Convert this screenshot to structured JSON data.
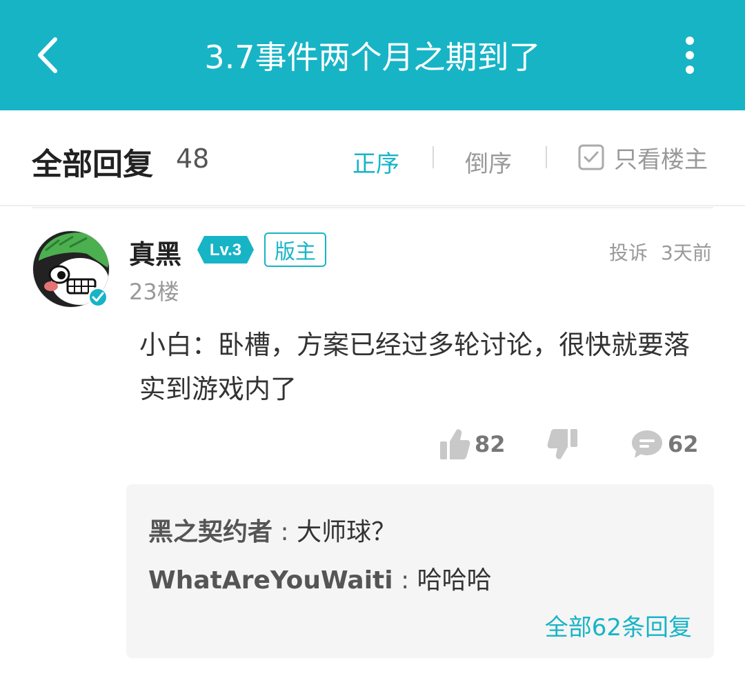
{
  "header": {
    "title": "3.7事件两个月之期到了",
    "back_icon": "chevron-left-icon",
    "more_icon": "more-vertical-icon",
    "bar_color": "#17b4c6"
  },
  "reply_header": {
    "title": "全部回复",
    "count": "48",
    "sort_asc": "正序",
    "sort_desc": "倒序",
    "only_op": "只看楼主",
    "active_sort": "正序"
  },
  "post": {
    "username": "真黑",
    "level": "Lv.3",
    "role": "版主",
    "report": "投诉",
    "time": "3天前",
    "floor": "23楼",
    "content": "小白：卧槽，方案已经过多轮讨论，很快就要落实到游戏内了",
    "likes": "82",
    "comments": "62",
    "accent_color": "#17b4c6"
  },
  "sub_replies": {
    "items": [
      {
        "user": "黑之契约者",
        "sep": ":",
        "text": "大师球？"
      },
      {
        "user": "WhatAreYouWaiti",
        "sep": ":",
        "text": "哈哈哈"
      }
    ],
    "view_all": "全部62条回复"
  }
}
